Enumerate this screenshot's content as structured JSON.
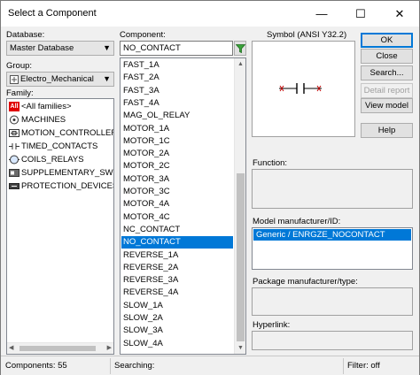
{
  "window": {
    "title": "Select a Component",
    "minimize": "—",
    "maximize": "☐",
    "close": "✕"
  },
  "database": {
    "label": "Database:",
    "value": "Master Database"
  },
  "group": {
    "label": "Group:",
    "value": "Electro_Mechanical"
  },
  "family": {
    "label": "Family:",
    "items": [
      {
        "label": "<All families>",
        "icon": "all-families-icon"
      },
      {
        "label": "MACHINES",
        "icon": "machine-icon"
      },
      {
        "label": "MOTION_CONTROLLERS",
        "icon": "motion-controller-icon"
      },
      {
        "label": "TIMED_CONTACTS",
        "icon": "timed-contact-icon"
      },
      {
        "label": "COILS_RELAYS",
        "icon": "coil-relay-icon"
      },
      {
        "label": "SUPPLEMENTARY_SWITCH",
        "icon": "switch-icon"
      },
      {
        "label": "PROTECTION_DEVICES",
        "icon": "protection-icon"
      }
    ],
    "selected": "COILS_RELAYS",
    "all_badge": "All"
  },
  "component": {
    "label": "Component:",
    "value": "NO_CONTACT",
    "items": [
      "FAST_1A",
      "FAST_2A",
      "FAST_3A",
      "FAST_4A",
      "MAG_OL_RELAY",
      "MOTOR_1A",
      "MOTOR_1C",
      "MOTOR_2A",
      "MOTOR_2C",
      "MOTOR_3A",
      "MOTOR_3C",
      "MOTOR_4A",
      "MOTOR_4C",
      "NC_CONTACT",
      "NO_CONTACT",
      "REVERSE_1A",
      "REVERSE_2A",
      "REVERSE_3A",
      "REVERSE_4A",
      "SLOW_1A",
      "SLOW_2A",
      "SLOW_3A",
      "SLOW_4A"
    ],
    "selected": "NO_CONTACT"
  },
  "symbol": {
    "label": "Symbol (ANSI Y32.2)"
  },
  "buttons": {
    "ok": "OK",
    "close": "Close",
    "search": "Search...",
    "detail_report": "Detail report",
    "view_model": "View model",
    "help": "Help"
  },
  "function": {
    "label": "Function:",
    "value": ""
  },
  "model_manufacturer": {
    "label": "Model manufacturer/ID:",
    "items": [
      "Generic / ENRGZE_NOCONTACT"
    ]
  },
  "package_manufacturer": {
    "label": "Package manufacturer/type:"
  },
  "hyperlink": {
    "label": "Hyperlink:"
  },
  "status": {
    "components": "Components: 55",
    "searching": "Searching:",
    "filter": "Filter: off"
  },
  "colors": {
    "selection": "#0078d7",
    "all_badge": "#e00000",
    "symbol_red": "#c00000"
  }
}
